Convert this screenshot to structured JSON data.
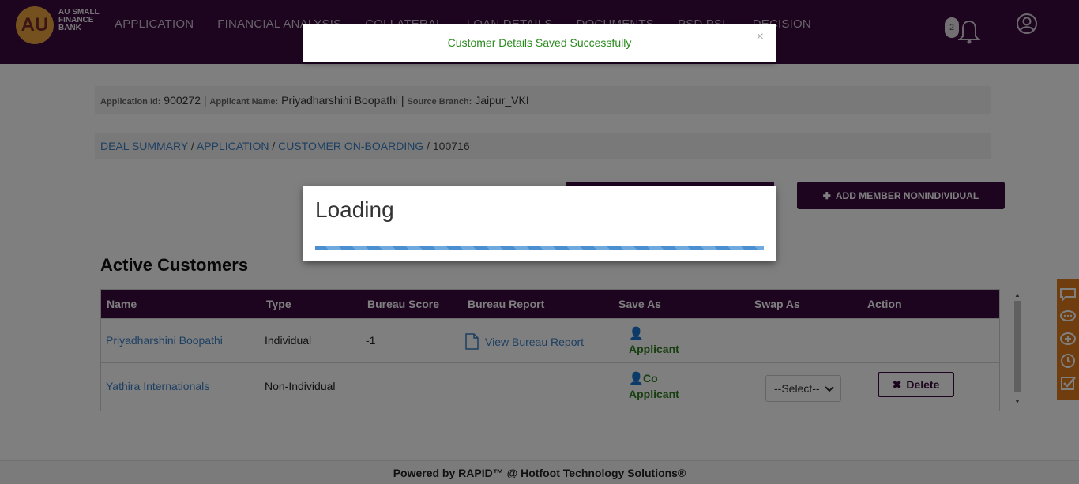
{
  "header": {
    "logo_mark": "AU",
    "logo_text": "AU SMALL FINANCE BANK",
    "nav": [
      "APPLICATION",
      "FINANCIAL ANALYSIS",
      "COLLATERAL",
      "LOAN DETAILS",
      "DOCUMENTS",
      "PSD PSL",
      "DECISION"
    ],
    "notification_count": "2",
    "icons": [
      "bell-icon",
      "user-icon"
    ]
  },
  "info": {
    "app_id_label": "Application Id:",
    "app_id": "900272 |",
    "applicant_label": "Applicant Name:",
    "applicant": "Priyadharshini Boopathi |",
    "branch_label": "Source Branch:",
    "branch": "Jaipur_VKI"
  },
  "breadcrumb": {
    "deal_summary": "DEAL SUMMARY",
    "application": "APPLICATION",
    "onboarding": "CUSTOMER ON-BOARDING",
    "current": "100716",
    "sep": "/"
  },
  "actions": {
    "add_nonindividual": "ADD MEMBER NONINDIVIDUAL"
  },
  "customers": {
    "title": "Active Customers",
    "columns": [
      "Name",
      "Type",
      "Bureau Score",
      "Bureau Report",
      "Save As",
      "Swap As",
      "Action"
    ],
    "rows": [
      {
        "name": "Priyadharshini Boopathi",
        "type": "Individual",
        "score": "-1",
        "report": "View Bureau Report",
        "save_as": "Applicant"
      },
      {
        "name": "Yathira Internationals",
        "type": "Non-Individual",
        "score": "",
        "report": "",
        "save_as_1": "Co",
        "save_as_2": "Applicant",
        "swap_select": "--Select--",
        "action": "Delete"
      }
    ]
  },
  "footer": {
    "text": "Powered by RAPID™ @ Hotfoot Technology Solutions®"
  },
  "toast": {
    "message": "Customer Details Saved Successfully",
    "close": "×"
  },
  "loading": {
    "title": "Loading"
  },
  "colors": {
    "brand": "#3a0a40",
    "accent_orange": "#e07a1c",
    "success": "#2a8a1e",
    "link": "#3a7fc4"
  }
}
